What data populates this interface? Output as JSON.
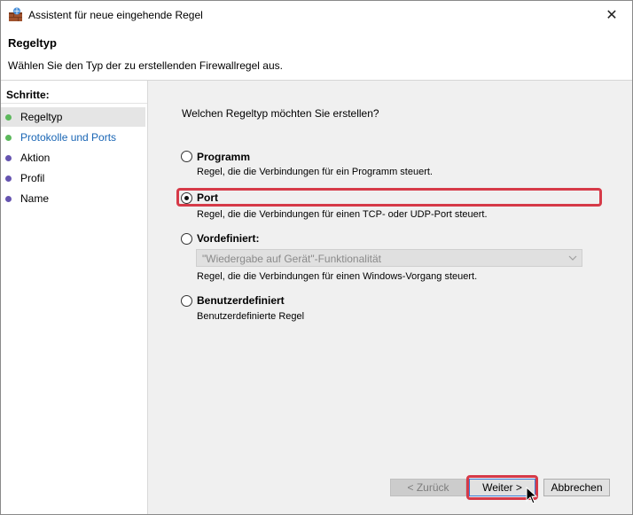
{
  "window": {
    "title": "Assistent für neue eingehende Regel",
    "close_glyph": "✕"
  },
  "header": {
    "title": "Regeltyp",
    "description": "Wählen Sie den Typ der zu erstellenden Firewallregel aus."
  },
  "sidebar": {
    "heading": "Schritte:",
    "steps": [
      {
        "label": "Regeltyp",
        "bullet_color": "#5cb85c",
        "text_color": "#000000"
      },
      {
        "label": "Protokolle und Ports",
        "bullet_color": "#5cb85c",
        "text_color": "#1a66b5"
      },
      {
        "label": "Aktion",
        "bullet_color": "#6654b0",
        "text_color": "#000000"
      },
      {
        "label": "Profil",
        "bullet_color": "#6654b0",
        "text_color": "#000000"
      },
      {
        "label": "Name",
        "bullet_color": "#6654b0",
        "text_color": "#000000"
      }
    ]
  },
  "main": {
    "question": "Welchen Regeltyp möchten Sie erstellen?",
    "options": [
      {
        "label": "Programm",
        "description": "Regel, die die Verbindungen für ein Programm steuert.",
        "checked": false
      },
      {
        "label": "Port",
        "description": "Regel, die die Verbindungen für einen TCP- oder UDP-Port steuert.",
        "checked": true
      },
      {
        "label": "Vordefiniert:",
        "description": "Regel, die die Verbindungen für einen Windows-Vorgang steuert.",
        "checked": false
      },
      {
        "label": "Benutzerdefiniert",
        "description": "Benutzerdefinierte Regel",
        "checked": false
      }
    ],
    "predefined_dropdown": {
      "selected": "\"Wiedergabe auf Gerät\"-Funktionalität",
      "disabled": true
    }
  },
  "buttons": {
    "back": "< Zurück",
    "next": "Weiter >",
    "cancel": "Abbrechen"
  },
  "colors": {
    "highlight": "#d63a48",
    "accent": "#3a7bd5"
  }
}
